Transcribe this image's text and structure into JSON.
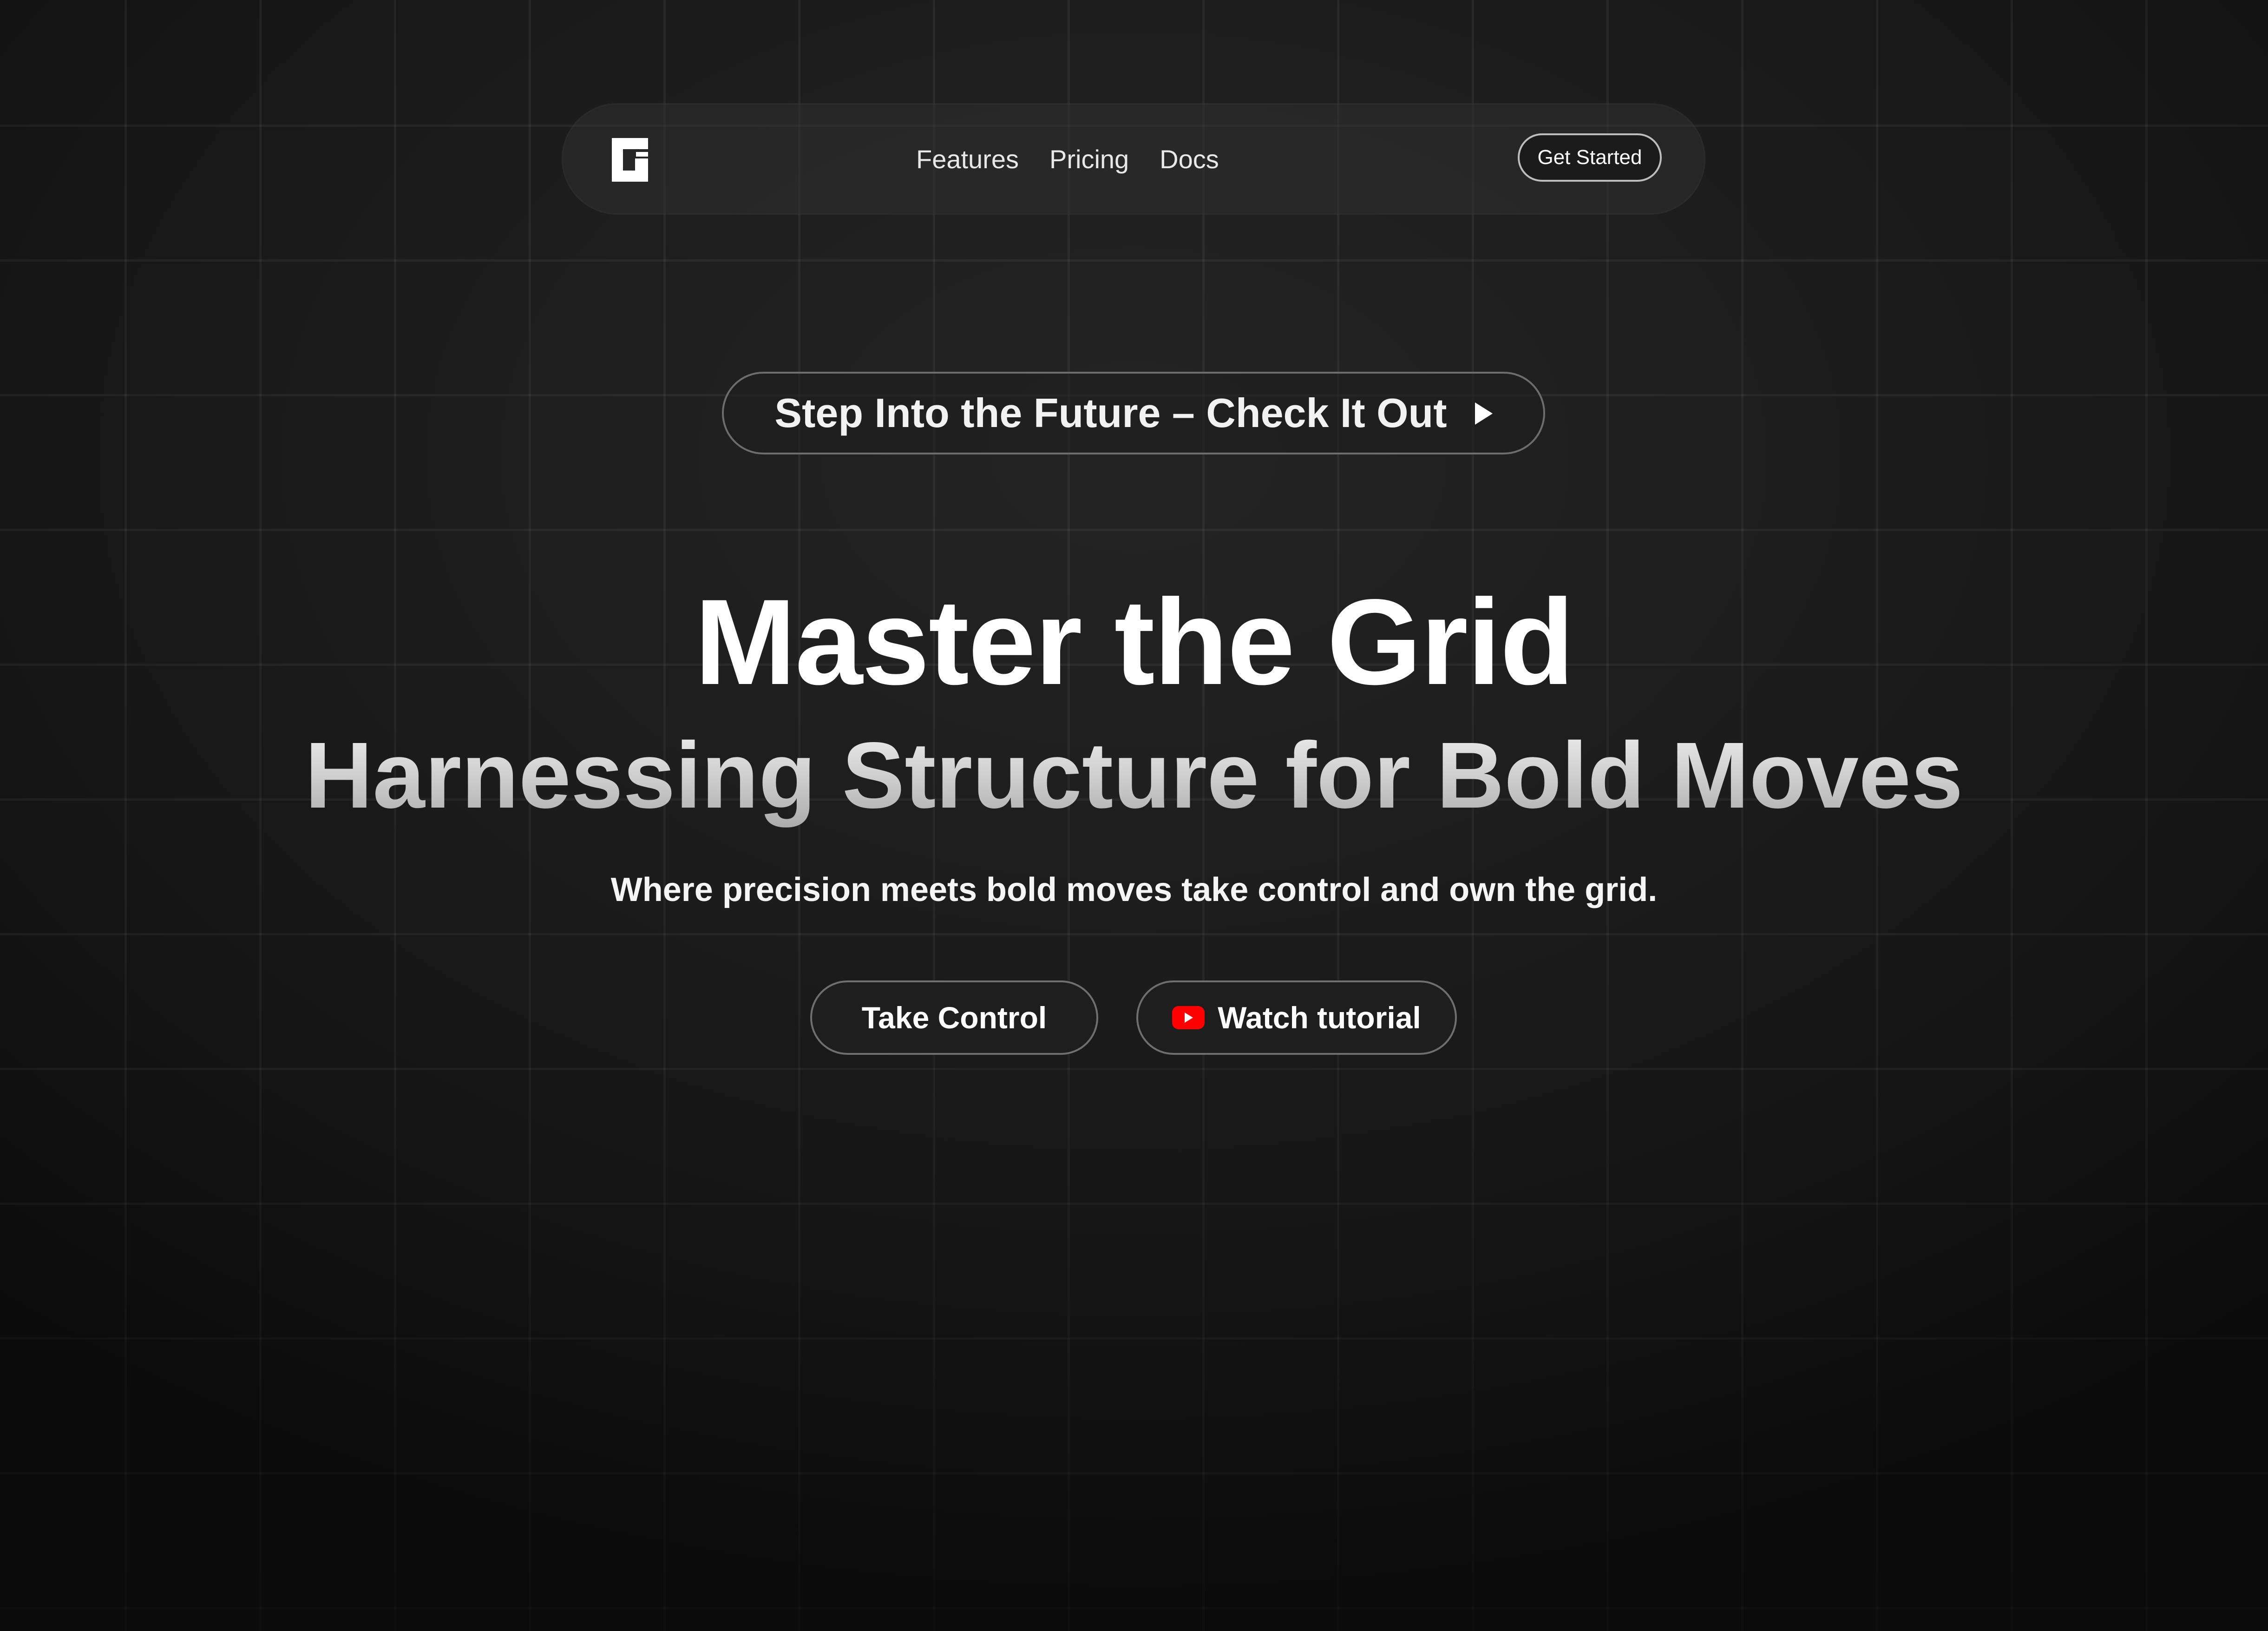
{
  "nav": {
    "logo_icon": "brand-logo-icon",
    "links": [
      {
        "label": "Features"
      },
      {
        "label": "Pricing"
      },
      {
        "label": "Docs"
      }
    ],
    "cta_label": "Get Started"
  },
  "announcement": {
    "text": "Step Into the Future – Check It Out",
    "icon": "play-icon"
  },
  "hero": {
    "title": "Master the Grid",
    "subtitle": "Harnessing Structure for Bold Moves",
    "tagline": "Where precision meets bold moves take control and own the grid.",
    "primary_button": "Take Control",
    "secondary_button": "Watch tutorial",
    "secondary_icon": "youtube-icon"
  },
  "colors": {
    "background": "#1c1c1c",
    "text": "#ffffff",
    "youtube_red": "#ff0000"
  }
}
